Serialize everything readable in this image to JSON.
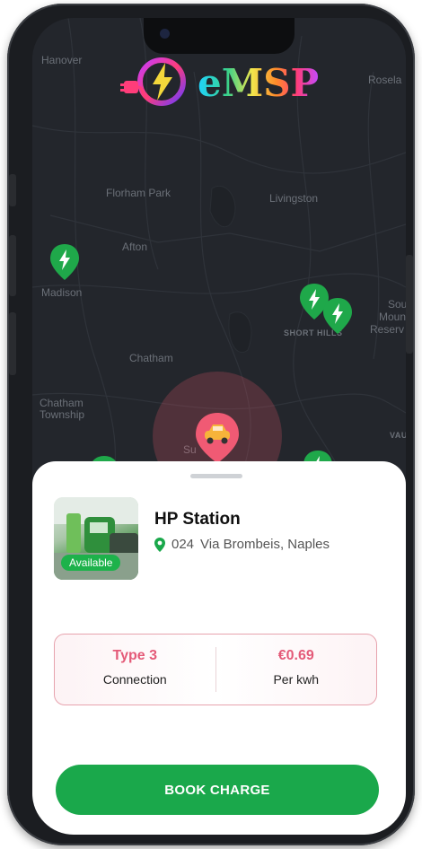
{
  "brand": {
    "name": "eMSP"
  },
  "map": {
    "labels": {
      "hanover": "Hanover",
      "roseland": "Rosela",
      "florham_park": "Florham Park",
      "livingston": "Livingston",
      "afton": "Afton",
      "madison": "Madison",
      "chatham": "Chatham",
      "chatham_township_1": "Chatham",
      "chatham_township_2": "Township",
      "short_hills": "SHORT HILLS",
      "south_mountain_1": "Sou",
      "south_mountain_2": "Moun",
      "south_mountain_3": "Reserv",
      "summit": "Su",
      "vauxhall": "VAU"
    }
  },
  "station": {
    "name": "HP Station",
    "address_number": "024",
    "address": "Via Brombeis, Naples",
    "status": "Available"
  },
  "info": {
    "connection_value": "Type 3",
    "connection_label": "Connection",
    "price_value": "€0.69",
    "price_label": "Per kwh"
  },
  "actions": {
    "book_label": "BOOK CHARGE"
  },
  "colors": {
    "accent_green": "#1aa84b",
    "accent_pink": "#e45a78"
  }
}
